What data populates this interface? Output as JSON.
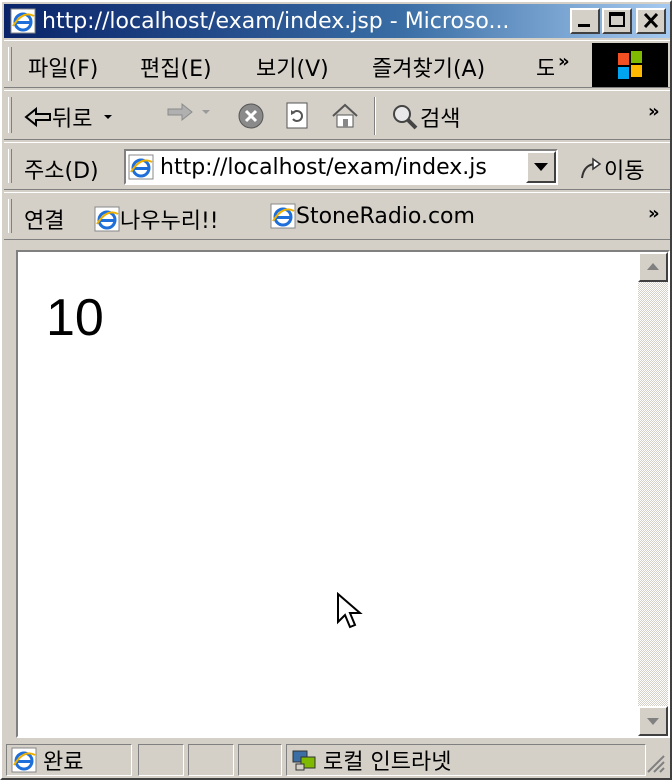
{
  "window": {
    "title": "http://localhost/exam/index.jsp - Microso..."
  },
  "menubar": {
    "items": [
      "파일(F)",
      "편집(E)",
      "보기(V)",
      "즐겨찾기(A)",
      "도"
    ],
    "overflow": "»"
  },
  "toolbar": {
    "back_label": "뒤로",
    "search_label": "검색",
    "overflow": "»"
  },
  "address": {
    "label": "주소(D)",
    "url": "http://localhost/exam/index.js",
    "go_label": "이동"
  },
  "links": {
    "label": "연결",
    "items": [
      "나우누리!!",
      "StoneRadio.com"
    ],
    "overflow": "»"
  },
  "page": {
    "value": "10"
  },
  "status": {
    "text": "완료",
    "zone": "로컬 인트라넷"
  },
  "colors": {
    "titlebar_start": "#0a246a",
    "titlebar_end": "#a6caf0",
    "chrome": "#d4d0c8"
  }
}
